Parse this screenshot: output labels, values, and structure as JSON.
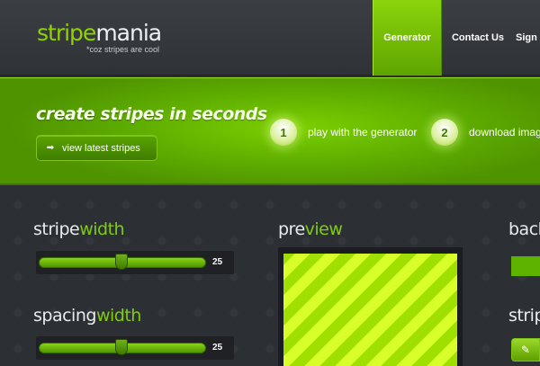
{
  "header": {
    "logo_part1": "stripe",
    "logo_part2": "mania",
    "tagline": "*coz stripes are cool",
    "nav": [
      {
        "label": "Generator",
        "active": true
      },
      {
        "label": "Contact Us",
        "active": false
      },
      {
        "label": "Sign Up",
        "active": false
      }
    ]
  },
  "banner": {
    "title": "create stripes in seconds",
    "button_label": "view latest stripes",
    "steps": [
      {
        "number": "1",
        "text": "play with the generator"
      },
      {
        "number": "2",
        "text": "download image"
      }
    ]
  },
  "stripe_width": {
    "title_part1": "stripe",
    "title_part2": "width",
    "value": "25"
  },
  "spacing_width": {
    "title_part1": "spacing",
    "title_part2": "width",
    "value": "25"
  },
  "preview": {
    "title_part1": "pre",
    "title_part2": "view"
  },
  "background": {
    "title_part1": "back"
  },
  "stripe_color": {
    "title_part1": "strip"
  },
  "colors": {
    "accent": "#7fcc12",
    "stripe_light": "#d8ff2a",
    "stripe_dark": "#a0e000",
    "background_color": "#5eb300"
  }
}
